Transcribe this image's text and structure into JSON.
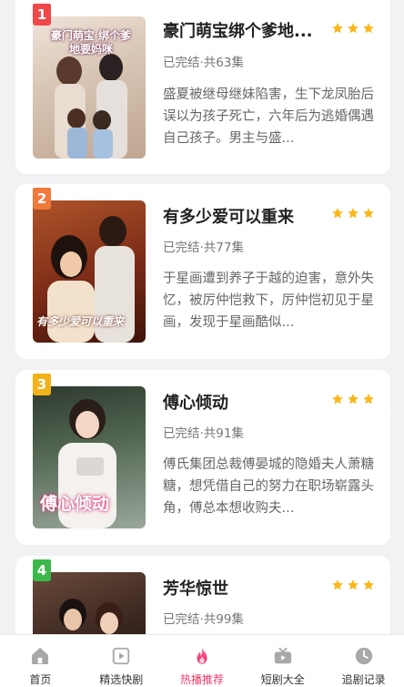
{
  "dramas": [
    {
      "rank": "1",
      "rank_color": "#f04848",
      "title": "豪门萌宝绑个爹地...",
      "status": "已完结·共63集",
      "description": "盛夏被继母继妹陷害，生下龙凤胎后误以为孩子死亡，六年后为逃婚偶遇自己孩子。男主与盛...",
      "poster_text": "豪门萌宝 绑个爹地要妈咪",
      "rating_stars": 3
    },
    {
      "rank": "2",
      "rank_color": "#f07a3e",
      "title": "有多少爱可以重来",
      "status": "已完结·共77集",
      "description": "于星画遭到养子于越的迫害，意外失忆，被厉仲恺救下，厉仲恺初见于星画，发现于星画酷似...",
      "poster_text": "有多少爱可以重来",
      "rating_stars": 3
    },
    {
      "rank": "3",
      "rank_color": "#f2b21a",
      "title": "傅心倾动",
      "status": "已完结·共91集",
      "description": "傅氏集团总裁傅晏城的隐婚夫人萧糖糖，想凭借自己的努力在职场崭露头角，傅总本想收购夫...",
      "poster_text": "傅心倾动",
      "rating_stars": 3
    },
    {
      "rank": "4",
      "rank_color": "#3cb84a",
      "title": "芳华惊世",
      "status": "已完结·共99集",
      "description": "",
      "poster_text": "",
      "rating_stars": 3
    }
  ],
  "star_color": "#f8b81d",
  "tabs": [
    {
      "label": "首页",
      "icon": "home-icon",
      "active": false
    },
    {
      "label": "精选快剧",
      "icon": "play-icon",
      "active": false
    },
    {
      "label": "热播推荐",
      "icon": "flame-icon",
      "active": true
    },
    {
      "label": "短剧大全",
      "icon": "tv-icon",
      "active": false
    },
    {
      "label": "追剧记录",
      "icon": "clock-icon",
      "active": false
    }
  ],
  "accent_color": "#f23a68"
}
